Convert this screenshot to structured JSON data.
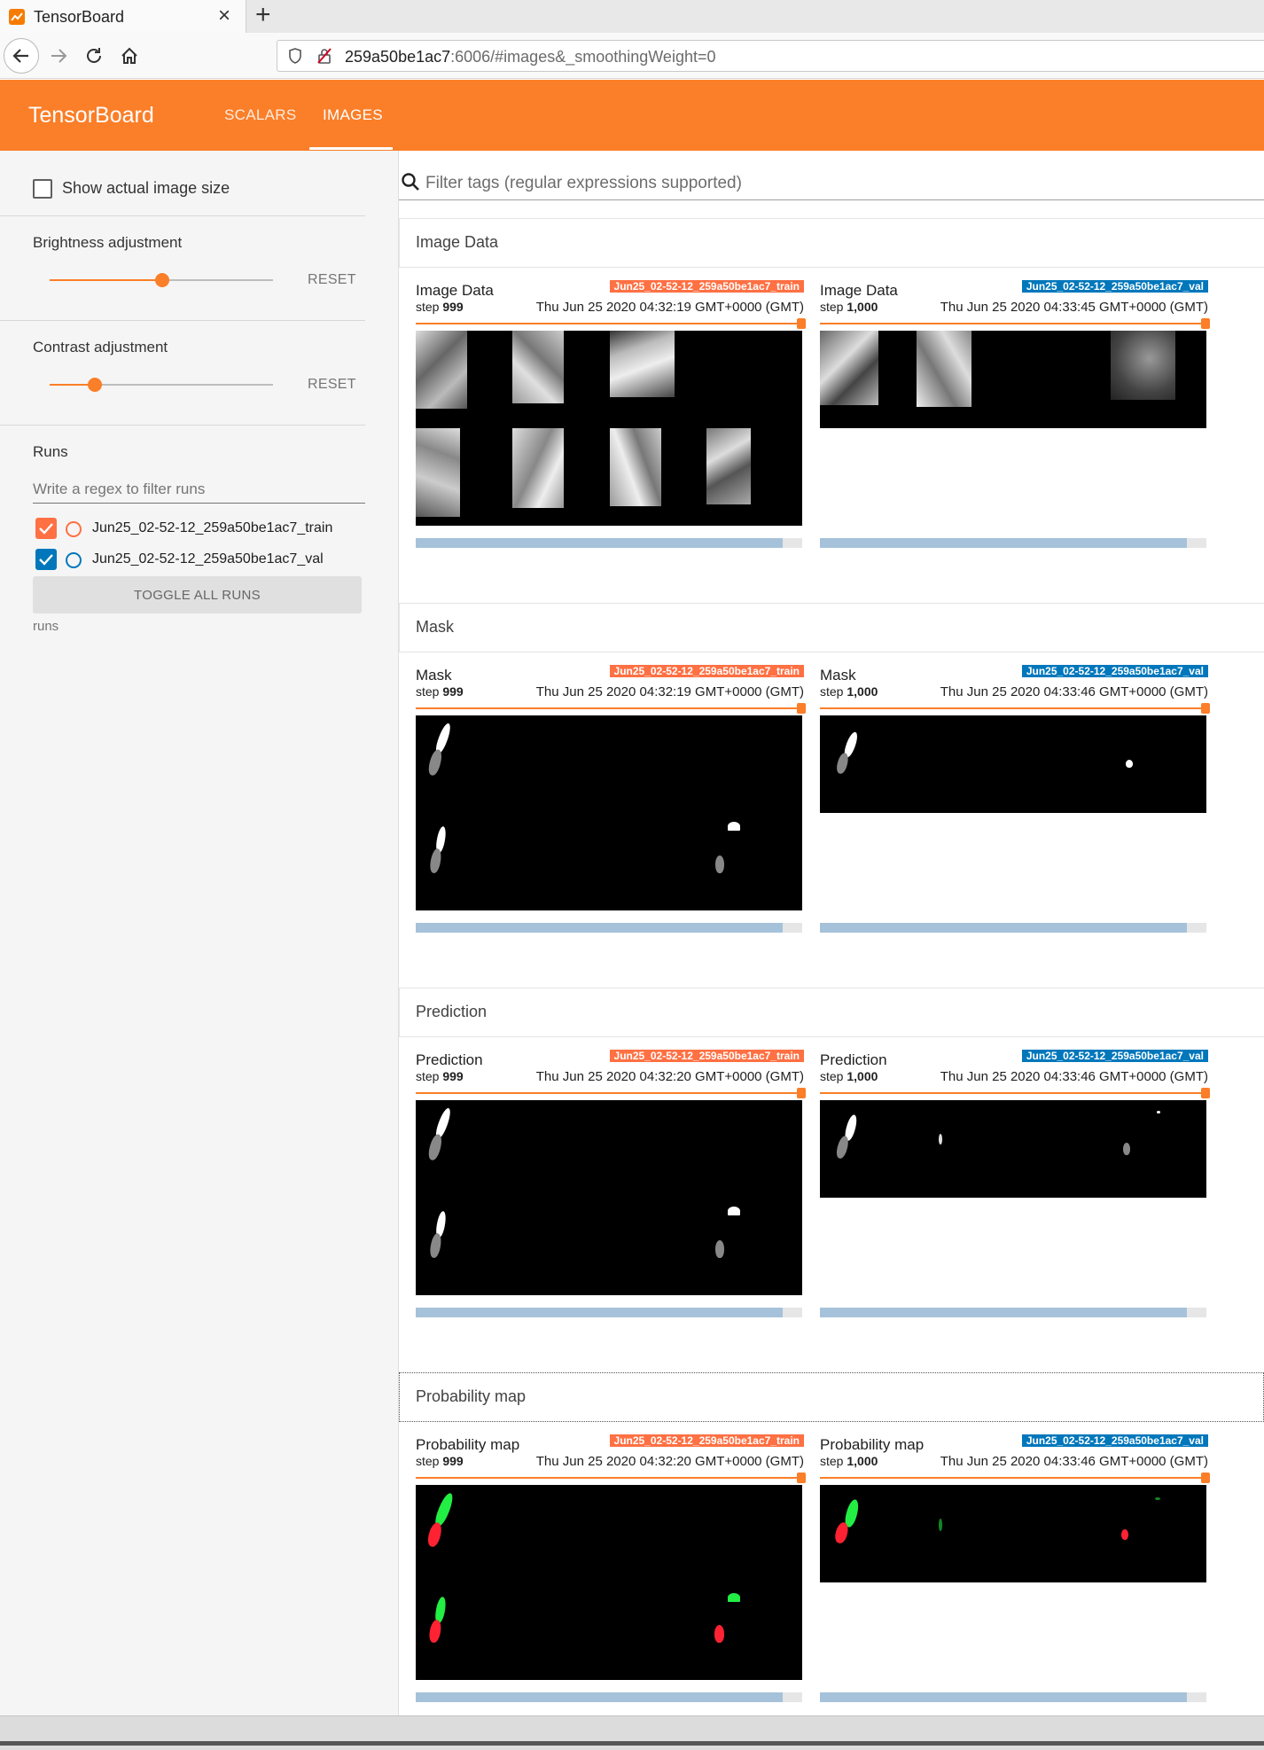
{
  "browser": {
    "tab_title": "TensorBoard",
    "tab_close": "×",
    "new_tab": "+",
    "url_host": "259a50be1ac7",
    "url_rest": ":6006/#images&_smoothingWeight=0"
  },
  "toolbar": {
    "brand": "TensorBoard",
    "tabs": [
      {
        "label": "SCALARS"
      },
      {
        "label": "IMAGES"
      }
    ],
    "active_tab": "IMAGES",
    "accent_color": "#fb7e28"
  },
  "sidebar": {
    "show_actual_size_label": "Show actual image size",
    "show_actual_size_checked": false,
    "brightness": {
      "label": "Brightness adjustment",
      "value": 0.5,
      "reset": "RESET"
    },
    "contrast": {
      "label": "Contrast adjustment",
      "value": 0.2,
      "reset": "RESET"
    },
    "runs": {
      "title": "Runs",
      "filter_placeholder": "Write a regex to filter runs",
      "items": [
        {
          "name": "Jun25_02-52-12_259a50be1ac7_train",
          "checked": true,
          "color": "#ff7043"
        },
        {
          "name": "Jun25_02-52-12_259a50be1ac7_val",
          "checked": true,
          "color": "#0077bb"
        }
      ],
      "toggle_all": "TOGGLE ALL RUNS",
      "footer": "runs"
    }
  },
  "main": {
    "filter_placeholder": "Filter tags (regular expressions supported)",
    "categories": [
      {
        "title": "Image Data",
        "cards": [
          {
            "title": "Image Data",
            "run": "Jun25_02-52-12_259a50be1ac7_train",
            "step_label": "step",
            "step": "999",
            "time": "Thu Jun 25 2020 04:32:19 GMT+0000 (GMT)"
          },
          {
            "title": "Image Data",
            "run": "Jun25_02-52-12_259a50be1ac7_val",
            "step_label": "step",
            "step": "1,000",
            "time": "Thu Jun 25 2020 04:33:45 GMT+0000 (GMT)"
          }
        ]
      },
      {
        "title": "Mask",
        "cards": [
          {
            "title": "Mask",
            "run": "Jun25_02-52-12_259a50be1ac7_train",
            "step_label": "step",
            "step": "999",
            "time": "Thu Jun 25 2020 04:32:19 GMT+0000 (GMT)"
          },
          {
            "title": "Mask",
            "run": "Jun25_02-52-12_259a50be1ac7_val",
            "step_label": "step",
            "step": "1,000",
            "time": "Thu Jun 25 2020 04:33:46 GMT+0000 (GMT)"
          }
        ]
      },
      {
        "title": "Prediction",
        "cards": [
          {
            "title": "Prediction",
            "run": "Jun25_02-52-12_259a50be1ac7_train",
            "step_label": "step",
            "step": "999",
            "time": "Thu Jun 25 2020 04:32:20 GMT+0000 (GMT)"
          },
          {
            "title": "Prediction",
            "run": "Jun25_02-52-12_259a50be1ac7_val",
            "step_label": "step",
            "step": "1,000",
            "time": "Thu Jun 25 2020 04:33:46 GMT+0000 (GMT)"
          }
        ]
      },
      {
        "title": "Probability map",
        "cards": [
          {
            "title": "Probability map",
            "run": "Jun25_02-52-12_259a50be1ac7_train",
            "step_label": "step",
            "step": "999",
            "time": "Thu Jun 25 2020 04:32:20 GMT+0000 (GMT)"
          },
          {
            "title": "Probability map",
            "run": "Jun25_02-52-12_259a50be1ac7_val",
            "step_label": "step",
            "step": "1,000",
            "time": "Thu Jun 25 2020 04:33:46 GMT+0000 (GMT)"
          }
        ]
      }
    ]
  }
}
